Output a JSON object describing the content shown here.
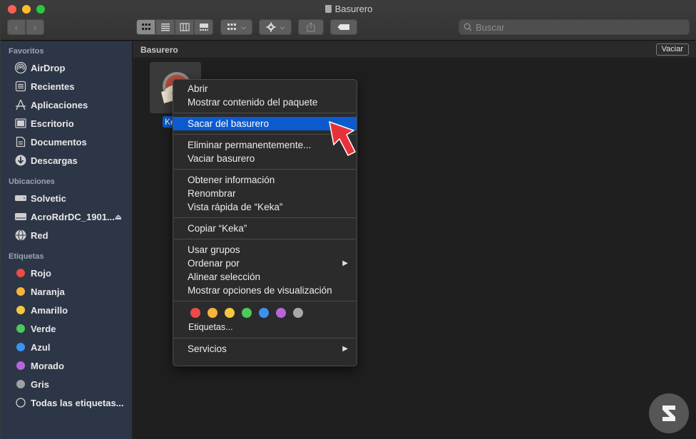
{
  "window": {
    "title": "Basurero"
  },
  "toolbar": {
    "search_placeholder": "Buscar"
  },
  "sidebar": {
    "favorites_heading": "Favoritos",
    "favorites": [
      {
        "label": "AirDrop",
        "icon": "airdrop-icon"
      },
      {
        "label": "Recientes",
        "icon": "recents-icon"
      },
      {
        "label": "Aplicaciones",
        "icon": "applications-icon"
      },
      {
        "label": "Escritorio",
        "icon": "desktop-icon"
      },
      {
        "label": "Documentos",
        "icon": "documents-icon"
      },
      {
        "label": "Descargas",
        "icon": "downloads-icon"
      }
    ],
    "locations_heading": "Ubicaciones",
    "locations": [
      {
        "label": "Solvetic",
        "icon": "hard-drive-icon"
      },
      {
        "label": "AcroRdrDC_1901...",
        "icon": "disk-image-icon"
      },
      {
        "label": "Red",
        "icon": "network-icon"
      }
    ],
    "tags_heading": "Etiquetas",
    "tags": [
      {
        "label": "Rojo",
        "color": "#ec4b46"
      },
      {
        "label": "Naranja",
        "color": "#f5b53b"
      },
      {
        "label": "Amarillo",
        "color": "#f5c63f"
      },
      {
        "label": "Verde",
        "color": "#4dc95a"
      },
      {
        "label": "Azul",
        "color": "#3b92ee"
      },
      {
        "label": "Morado",
        "color": "#b865dc"
      },
      {
        "label": "Gris",
        "color": "#9ea0a4"
      }
    ],
    "all_tags": "Todas las etiquetas..."
  },
  "pathbar": {
    "location": "Basurero",
    "empty_button": "Vaciar"
  },
  "file": {
    "label": "Ke"
  },
  "context_menu": {
    "open": "Abrir",
    "show_package": "Mostrar contenido del paquete",
    "put_back": "Sacar del basurero",
    "delete_immediately": "Eliminar permanentemente...",
    "empty_trash": "Vaciar basurero",
    "get_info": "Obtener información",
    "rename": "Renombrar",
    "quick_look": "Vista rápida de “Keka”",
    "copy": "Copiar “Keka”",
    "use_groups": "Usar grupos",
    "sort_by": "Ordenar por",
    "align": "Alinear selección",
    "view_options": "Mostrar opciones de visualización",
    "tag_colors": [
      "#ec4b46",
      "#f5b53b",
      "#f5c63f",
      "#4dc95a",
      "#3b92ee",
      "#b865dc",
      "#a8a8a8"
    ],
    "tags": "Etiquetas...",
    "services": "Servicios"
  },
  "colors": {
    "highlight": "#0b5bcf",
    "annotation_arrow": "#e8323a"
  }
}
